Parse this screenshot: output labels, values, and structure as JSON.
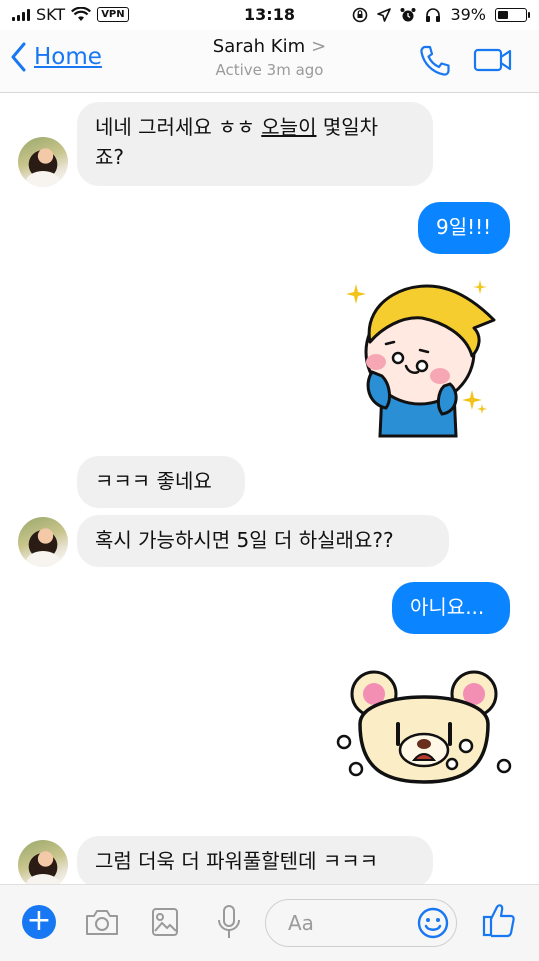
{
  "status_bar": {
    "carrier": "SKT",
    "vpn": "VPN",
    "time": "13:18",
    "battery": "39%",
    "battery_level": 0.39
  },
  "header": {
    "back_label": "Home",
    "contact_name": "Sarah Kim",
    "active_status": "Active 3m ago"
  },
  "messages": [
    {
      "side": "incoming",
      "line1_pre": "네네 그러세요 ㅎㅎ ",
      "line1_link": "오늘이",
      "line1_post": " 몇일차",
      "line2": "죠?"
    },
    {
      "side": "outgoing",
      "text": "9일!!!"
    },
    {
      "side": "outgoing",
      "type": "sticker",
      "sticker": "blonde-boy-sticker"
    },
    {
      "side": "incoming",
      "text": "ㅋㅋㅋ 좋네요"
    },
    {
      "side": "incoming",
      "text": "혹시 가능하시면 5일 더 하실래요??"
    },
    {
      "side": "outgoing",
      "text": "아니요..."
    },
    {
      "side": "outgoing",
      "type": "sticker",
      "sticker": "crying-bear-sticker"
    },
    {
      "side": "incoming",
      "text": "그럼 더욱 더 파워풀할텐데 ㅋㅋㅋ"
    }
  ],
  "composer": {
    "placeholder": "Aa"
  },
  "icons": {
    "toolbar": [
      "plus-icon",
      "camera-icon",
      "gallery-icon",
      "microphone-icon",
      "emoji-icon",
      "thumbs-up-icon"
    ],
    "header": [
      "back-chevron-icon",
      "phone-icon",
      "video-camera-icon"
    ]
  },
  "colors": {
    "accent": "#1877f2",
    "outgoing_bubble": "#0a84ff",
    "incoming_bubble": "#f1f0f0"
  }
}
